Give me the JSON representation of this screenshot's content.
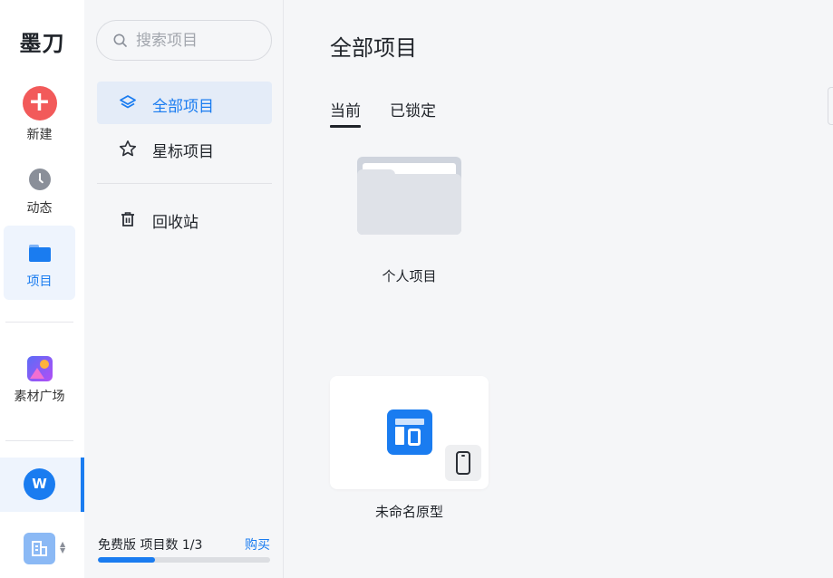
{
  "app": {
    "logo_text": "墨刀"
  },
  "rail": {
    "items": [
      {
        "label": "新建",
        "icon": "plus-icon"
      },
      {
        "label": "动态",
        "icon": "clock-icon"
      },
      {
        "label": "项目",
        "icon": "folder-icon",
        "active": true
      },
      {
        "label": "素材广场",
        "icon": "material-gallery-icon"
      }
    ],
    "avatar_letter": "W",
    "org_icon": "building-icon"
  },
  "panel": {
    "search": {
      "placeholder": "搜索项目",
      "value": ""
    },
    "nav": [
      {
        "label": "全部项目",
        "icon": "layers-icon",
        "active": true
      },
      {
        "label": "星标项目",
        "icon": "star-icon"
      },
      {
        "label": "回收站",
        "icon": "trash-icon"
      }
    ],
    "plan": {
      "text": "免费版 项目数 1/3",
      "buy_label": "购买",
      "used": 1,
      "total": 3
    }
  },
  "main": {
    "title": "全部项目",
    "tabs": [
      {
        "label": "当前",
        "active": true
      },
      {
        "label": "已锁定"
      }
    ],
    "folders": [
      {
        "name": "个人项目"
      }
    ],
    "prototypes": [
      {
        "name": "未命名原型",
        "device": "phone-icon"
      }
    ]
  },
  "colors": {
    "accent": "#1a7cf0",
    "new_button": "#f25a5a"
  }
}
